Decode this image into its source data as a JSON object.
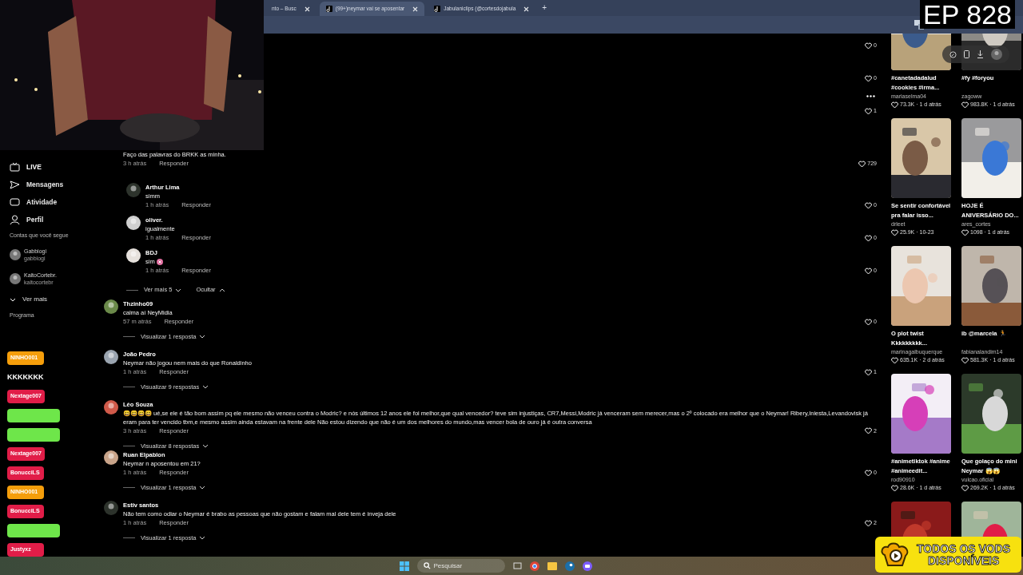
{
  "browser": {
    "tabs": [
      {
        "title": "nto – Busc",
        "selected": false
      },
      {
        "title": "(99+)neymar vai se aposentar",
        "selected": true
      },
      {
        "title": "Jabulaniclips (@cortesdojabula",
        "selected": false
      }
    ],
    "new_tab": "+"
  },
  "overlay_title": "EP 828",
  "sidebar": {
    "items": [
      {
        "kind": "live",
        "label": "LIVE"
      },
      {
        "kind": "messages",
        "label": "Mensagens"
      },
      {
        "kind": "activity",
        "label": "Atividade"
      },
      {
        "kind": "profile",
        "label": "Perfil"
      },
      {
        "kind": "heading",
        "label": "Contas que você segue"
      },
      {
        "kind": "account",
        "label": "Gabbiogi",
        "sub": "gabbiogi"
      },
      {
        "kind": "account",
        "label": "KaitoCortebr.",
        "sub": "kaitocortebr"
      },
      {
        "kind": "more",
        "label": "Ver mais"
      },
      {
        "kind": "heading",
        "label": "Programa"
      }
    ]
  },
  "chat_badges": [
    {
      "kind": "user",
      "text": "NINHO001",
      "color": "#f59e0b"
    },
    {
      "kind": "message",
      "text": "KKKKKKK"
    },
    {
      "kind": "user",
      "text": "Nextage007",
      "color": "#e11d48"
    },
    {
      "kind": "user",
      "color": "#6ee64a"
    },
    {
      "kind": "user",
      "color": "#6ee64a"
    },
    {
      "kind": "user",
      "text": "Nextage007",
      "color": "#e11d48"
    },
    {
      "kind": "user",
      "text": "BonucciLS",
      "color": "#e11d48"
    },
    {
      "kind": "user",
      "text": "NINHO001",
      "color": "#f59e0b"
    },
    {
      "kind": "user",
      "text": "BonucciLS",
      "color": "#e11d48"
    },
    {
      "kind": "user",
      "color": "#6ee64a"
    },
    {
      "kind": "user",
      "text": "Justyxz",
      "color": "#e11d48"
    }
  ],
  "comments": {
    "hidden_likes": [
      "0",
      "0",
      "1"
    ],
    "items": [
      {
        "kind": "comment",
        "text": "Faço das palavras do BRKK as minha.",
        "time": "3 h atrás",
        "reply": "Responder",
        "likes": "729"
      },
      {
        "kind": "reply",
        "name": "Arthur Lima",
        "text": "simm",
        "time": "1 h atrás",
        "reply": "Responder",
        "likes": "0"
      },
      {
        "kind": "reply",
        "name": "oliver.",
        "text": "igualmente",
        "time": "1 h atrás",
        "reply": "Responder",
        "likes": "0"
      },
      {
        "kind": "reply",
        "name": "BDJ",
        "text": "sim",
        "emoji_icon": true,
        "time": "1 h atrás",
        "reply": "Responder",
        "likes": "0"
      },
      {
        "kind": "thread_controls",
        "more": "Ver mais 5",
        "hide": "Ocultar"
      },
      {
        "kind": "comment",
        "name": "Thzinho09",
        "text": "calma aí NeyMidia",
        "time": "57 m atrás",
        "reply": "Responder",
        "likes": "0",
        "replies": "Visualizar 1 resposta"
      },
      {
        "kind": "comment",
        "name": "João Pedro",
        "text": "Neymar não jogou nem mais do que Ronaldinho",
        "time": "1 h atrás",
        "reply": "Responder",
        "likes": "1",
        "replies": "Visualizar 9 respostas"
      },
      {
        "kind": "comment",
        "name": "Léo Souza",
        "text": "😄😄😄😄 ué,se ele é tão bom assim pq ele mesmo não venceu contra o Modric? e nós últimos 12 anos ele foi melhor,que qual vencedor? teve sim injustiças, CR7,Messi,Modric já venceram sem merecer,mas o 2º colocado era melhor que o Neymar! Ribery,Iniesta,Levandovisk já eram para ter vencido tbm,e mesmo assim ainda estavam na frente dele Não estou dizendo que não é um dos melhores do mundo,mas vencer bola de ouro já é outra conversa",
        "time": "3 h atrás",
        "reply": "Responder",
        "likes": "2",
        "replies": "Visualizar 8 respostas"
      },
      {
        "kind": "comment",
        "name": "Ruan Elpablon",
        "text": "Neymar n aposentou em 21?",
        "time": "1 h atrás",
        "reply": "Responder",
        "likes": "0",
        "replies": "Visualizar 1 resposta"
      },
      {
        "kind": "comment",
        "name": "Estiv santos",
        "text": "Não tem como odiar o Neymar é brabo as pessoas que não gostam e falam mal dele tem é inveja dele",
        "time": "1 h atrás",
        "reply": "Responder",
        "likes": "2",
        "replies": "Visualizar 1 resposta"
      }
    ]
  },
  "videos": [
    {
      "kind": "video",
      "caption": "#canetadadalud #cookies #irma...",
      "author": "mariaselma04",
      "stats": "73.3K · 1 d atrás"
    },
    {
      "kind": "video",
      "caption": "#fy #foryou",
      "author": "zagoww",
      "stats": "983.8K · 1 d atrás"
    },
    {
      "kind": "video",
      "caption": "Se sentir confortável pra falar isso...",
      "author": "drleet",
      "stats": "25.9K · 10-23"
    },
    {
      "kind": "video",
      "caption": "HOJE É ANIVERSÁRIO DO...",
      "author": "ares_cortes",
      "stats": "1098 · 1 d atrás"
    },
    {
      "kind": "video",
      "caption": "O plot twist Kkkkkkkkk...",
      "author": "marinagalbuquerque",
      "stats": "635.1K · 2 d atrás"
    },
    {
      "kind": "video",
      "caption": "ib @marcela 🏃",
      "author": "fabianalandim14",
      "stats": "581.3K · 1 d atrás"
    },
    {
      "kind": "video",
      "caption": "#animetiktok #anime #animeedit...",
      "author": "rod90910",
      "stats": "28.6K · 1 d atrás"
    },
    {
      "kind": "video",
      "caption": "Que golaço do mini Neymar 😱😱",
      "author": "vulcao.oficial",
      "stats": "269.2K · 1 d atrás"
    },
    {
      "kind": "picture"
    },
    {
      "kind": "picture"
    }
  ],
  "taskbar": {
    "search_placeholder": "Pesquisar"
  },
  "promo": {
    "line1": "TODOS OS VODS",
    "line2": "DISPONÍVEIS"
  }
}
